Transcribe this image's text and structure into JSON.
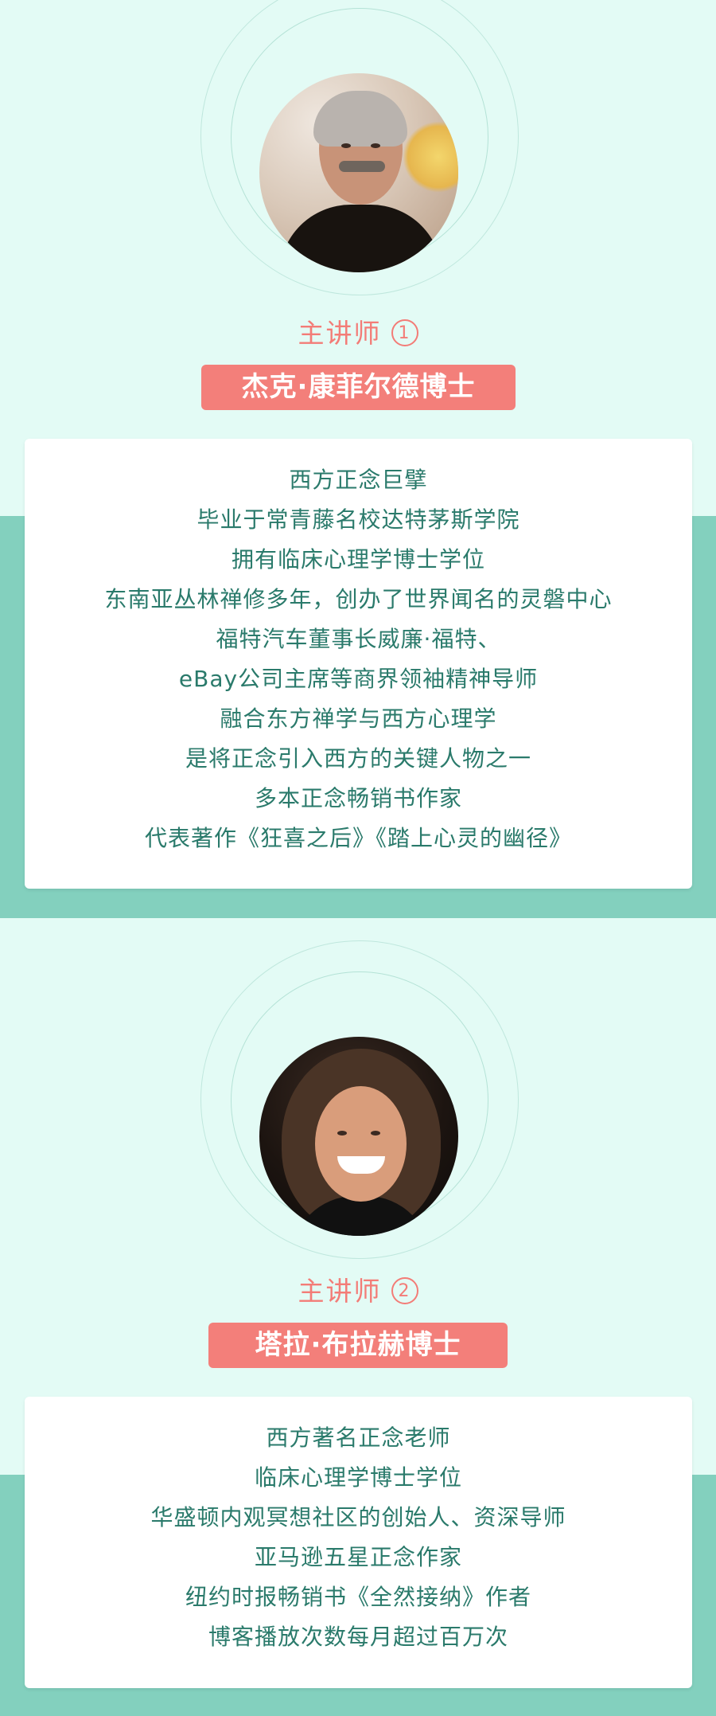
{
  "speakers": [
    {
      "label": "主讲师",
      "number": "1",
      "name": "杰克·康菲尔德博士",
      "bio_lines": [
        "西方正念巨擘",
        "毕业于常青藤名校达特茅斯学院",
        "拥有临床心理学博士学位",
        "东南亚丛林禅修多年，创办了世界闻名的灵磐中心",
        "福特汽车董事长威廉·福特、",
        "eBay公司主席等商界领袖精神导师",
        "融合东方禅学与西方心理学",
        "是将正念引入西方的关键人物之一",
        "多本正念畅销书作家",
        "代表著作《狂喜之后》《踏上心灵的幽径》"
      ]
    },
    {
      "label": "主讲师",
      "number": "2",
      "name": "塔拉·布拉赫博士",
      "bio_lines": [
        "西方著名正念老师",
        "临床心理学博士学位",
        "华盛顿内观冥想社区的创始人、资深导师",
        "亚马逊五星正念作家",
        "纽约时报畅销书《全然接纳》作者",
        "博客播放次数每月超过百万次"
      ]
    }
  ],
  "colors": {
    "background": "#e3fbf5",
    "band": "#83d0be",
    "accent": "#f37f7a",
    "text": "#2a7a6b"
  }
}
